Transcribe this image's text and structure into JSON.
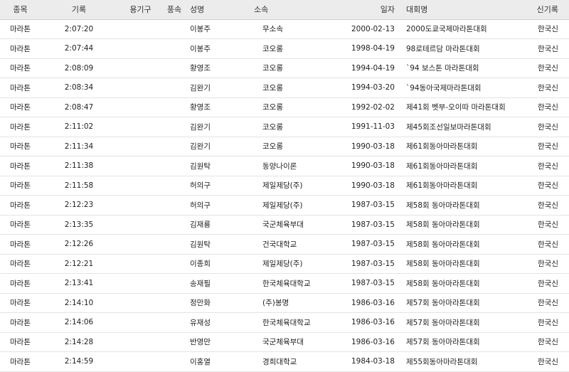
{
  "headers": {
    "event": "종목",
    "record": "기록",
    "equipment": "용기구",
    "wind": "풍속",
    "name": "성명",
    "affiliation": "소속",
    "date": "일자",
    "meet": "대회명",
    "new_record": "신기록"
  },
  "rows": [
    {
      "event": "마라톤",
      "record": "2:07:20",
      "equipment": "",
      "wind": "",
      "name": "이봉주",
      "affiliation": "무소속",
      "date": "2000-02-13",
      "meet": "2000도쿄국제마라톤대회",
      "new_record": "한국신"
    },
    {
      "event": "마라톤",
      "record": "2:07:44",
      "equipment": "",
      "wind": "",
      "name": "이봉주",
      "affiliation": "코오롱",
      "date": "1998-04-19",
      "meet": "98로테르담 마라톤대회",
      "new_record": "한국신"
    },
    {
      "event": "마라톤",
      "record": "2:08:09",
      "equipment": "",
      "wind": "",
      "name": "황영조",
      "affiliation": "코오롱",
      "date": "1994-04-19",
      "meet": "`94 보스톤 마라톤대회",
      "new_record": "한국신"
    },
    {
      "event": "마라톤",
      "record": "2:08:34",
      "equipment": "",
      "wind": "",
      "name": "김완기",
      "affiliation": "코오롱",
      "date": "1994-03-20",
      "meet": "`94동아국제마라톤대회",
      "new_record": "한국신"
    },
    {
      "event": "마라톤",
      "record": "2:08:47",
      "equipment": "",
      "wind": "",
      "name": "황영조",
      "affiliation": "코오롱",
      "date": "1992-02-02",
      "meet": "제41회 벳부-오이따 마라톤대회",
      "new_record": "한국신"
    },
    {
      "event": "마라톤",
      "record": "2:11:02",
      "equipment": "",
      "wind": "",
      "name": "김완기",
      "affiliation": "코오롱",
      "date": "1991-11-03",
      "meet": "제45회조선일보마라톤대회",
      "new_record": "한국신"
    },
    {
      "event": "마라톤",
      "record": "2:11:34",
      "equipment": "",
      "wind": "",
      "name": "김완기",
      "affiliation": "코오롱",
      "date": "1990-03-18",
      "meet": "제61회동아마라톤대회",
      "new_record": "한국신"
    },
    {
      "event": "마라톤",
      "record": "2:11:38",
      "equipment": "",
      "wind": "",
      "name": "김원탁",
      "affiliation": "동양나이론",
      "date": "1990-03-18",
      "meet": "제61회동아마라톤대회",
      "new_record": "한국신"
    },
    {
      "event": "마라톤",
      "record": "2:11:58",
      "equipment": "",
      "wind": "",
      "name": "허의구",
      "affiliation": "제일제당(주)",
      "date": "1990-03-18",
      "meet": "제61회동아마라톤대회",
      "new_record": "한국신"
    },
    {
      "event": "마라톤",
      "record": "2:12:23",
      "equipment": "",
      "wind": "",
      "name": "허의구",
      "affiliation": "제일제당(주)",
      "date": "1987-03-15",
      "meet": "제58회 동아마라톤대회",
      "new_record": "한국신"
    },
    {
      "event": "마라톤",
      "record": "2:13:35",
      "equipment": "",
      "wind": "",
      "name": "김재룡",
      "affiliation": "국군체육부대",
      "date": "1987-03-15",
      "meet": "제58회 동아마라톤대회",
      "new_record": "한국신"
    },
    {
      "event": "마라톤",
      "record": "2:12:26",
      "equipment": "",
      "wind": "",
      "name": "김원탁",
      "affiliation": "건국대학교",
      "date": "1987-03-15",
      "meet": "제58회 동아마라톤대회",
      "new_record": "한국신"
    },
    {
      "event": "마라톤",
      "record": "2:12:21",
      "equipment": "",
      "wind": "",
      "name": "이종희",
      "affiliation": "제일제당(주)",
      "date": "1987-03-15",
      "meet": "제58회 동아마라톤대회",
      "new_record": "한국신"
    },
    {
      "event": "마라톤",
      "record": "2:13:41",
      "equipment": "",
      "wind": "",
      "name": "송재필",
      "affiliation": "한국체육대학교",
      "date": "1987-03-15",
      "meet": "제58회 동아마라톤대회",
      "new_record": "한국신"
    },
    {
      "event": "마라톤",
      "record": "2:14:10",
      "equipment": "",
      "wind": "",
      "name": "정만화",
      "affiliation": "(주)봉명",
      "date": "1986-03-16",
      "meet": "제57회 동아마라톤대회",
      "new_record": "한국신"
    },
    {
      "event": "마라톤",
      "record": "2:14:06",
      "equipment": "",
      "wind": "",
      "name": "유재성",
      "affiliation": "한국체육대학교",
      "date": "1986-03-16",
      "meet": "제57회 동아마라톤대회",
      "new_record": "한국신"
    },
    {
      "event": "마라톤",
      "record": "2:14:28",
      "equipment": "",
      "wind": "",
      "name": "반영만",
      "affiliation": "국군체육부대",
      "date": "1986-03-16",
      "meet": "제57회 동아마라톤대회",
      "new_record": "한국신"
    },
    {
      "event": "마라톤",
      "record": "2:14:59",
      "equipment": "",
      "wind": "",
      "name": "이홍열",
      "affiliation": "경희대학교",
      "date": "1984-03-18",
      "meet": "제55회동아마라톤대회",
      "new_record": "한국신"
    }
  ]
}
